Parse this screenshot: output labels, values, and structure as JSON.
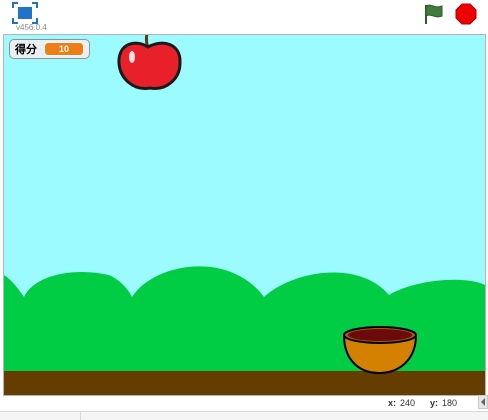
{
  "toolbar": {
    "version": "v456.0.4",
    "fullscreen_icon": "fullscreen-icon",
    "flag_icon": "green-flag-icon",
    "stop_icon": "stop-icon"
  },
  "monitor": {
    "label": "得分",
    "value": "10"
  },
  "stage": {
    "sky_color": "#9bfbff",
    "hill_color": "#00cc44",
    "ground_color": "#663d00",
    "sprites": [
      "apple",
      "basket"
    ]
  },
  "coords": {
    "x_label": "x:",
    "x_value": "240",
    "y_label": "y:",
    "y_value": "180"
  },
  "colors": {
    "monitor_value_bg": "#ee7d16",
    "stop_red": "#ee0000",
    "flag_green": "#3f7b3a",
    "fullscreen_blue": "#1f74c9"
  }
}
